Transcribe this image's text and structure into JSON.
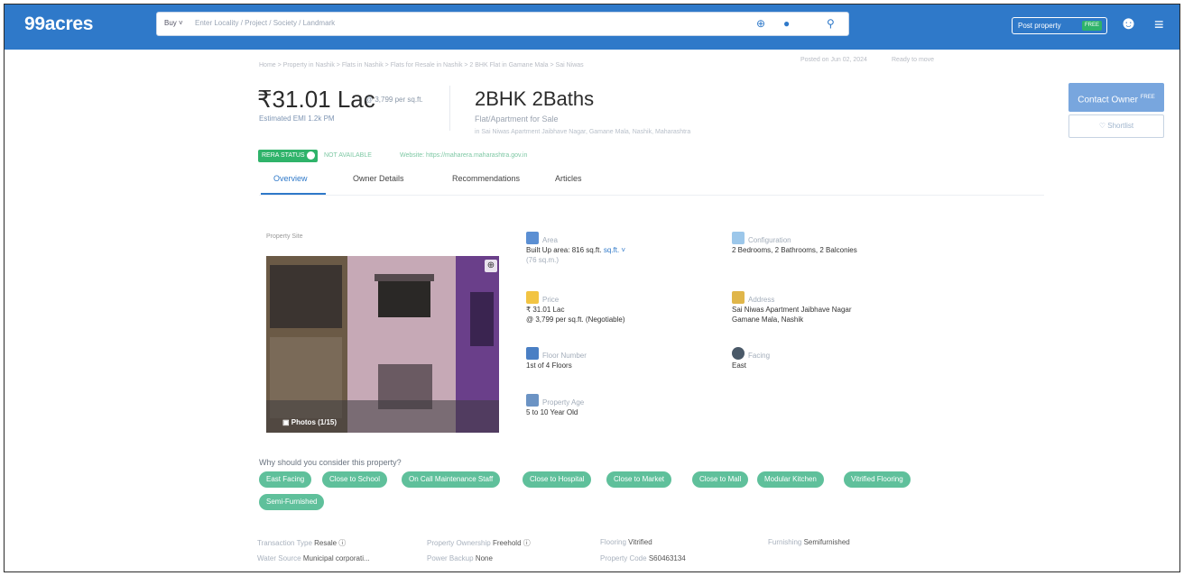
{
  "header": {
    "logo": "99acres",
    "buy_label": "Buy ˅",
    "search_placeholder": "Enter Locality / Project / Society / Landmark",
    "post_property_label": "Post property",
    "post_property_badge": "FREE"
  },
  "breadcrumb_text": "Home > Property in Nashik > Flats in Nashik > Flats for Resale in Nashik > 2 BHK Flat in Gamane Mala > Sai Niwas",
  "posted_text": "Posted on Jun 02, 2024",
  "ready_text": "Ready to move",
  "listing": {
    "price": "31.01 Lac",
    "price_sub": "@ 3,799 per sq.ft.",
    "estimated_emi": "Estimated EMI 1.2k PM",
    "title": "2BHK 2Baths",
    "subtitle": "Flat/Apartment for Sale",
    "address_line": "in Sai Niwas Apartment Jaibhave Nagar, Gamane Mala, Nashik, Maharashtra",
    "rera_status": "RERA STATUS",
    "rera_number": "NOT AVAILABLE",
    "rera_website": "Website: https://maharera.maharashtra.gov.in"
  },
  "actions": {
    "contact_owner": "Contact Owner",
    "contact_badge": "FREE",
    "shortlist": "♡ Shortlist"
  },
  "tabs": [
    "Overview",
    "Owner Details",
    "Recommendations",
    "Articles"
  ],
  "photo": {
    "label": "Property Site",
    "count": "▣ Photos (1/15)"
  },
  "attributes": {
    "area_key": "Area",
    "area_value": "Built Up area: 816 sq.ft.",
    "area_unit": "sq.ft. ˅",
    "area_more": "(76 sq.m.)",
    "config_key": "Configuration",
    "config_value": "2 Bedrooms, 2 Bathrooms, 2 Balconies",
    "price_key": "Price",
    "price_value": "₹ 31.01 Lac",
    "price_sub": "@ 3,799 per sq.ft. (Negotiable)",
    "address_key": "Address",
    "address_line1": "Sai Niwas Apartment Jaibhave Nagar",
    "address_line2": "Gamane Mala, Nashik",
    "floor_key": "Floor Number",
    "floor_value": "1st of 4 Floors",
    "facing_key": "Facing",
    "facing_value": "East",
    "age_key": "Property Age",
    "age_value": "5 to 10 Year Old"
  },
  "why": {
    "heading": "Why should you consider this property?",
    "chips": [
      "East Facing",
      "Close to School",
      "On Call Maintenance Staff",
      "Close to Hospital",
      "Close to Market",
      "Close to Mall",
      "Modular Kitchen",
      "Vitrified Flooring",
      "Semi-Furnished"
    ]
  },
  "footer_facts": [
    {
      "key": "Transaction Type",
      "value": "Resale ⓘ"
    },
    {
      "key": "Property Ownership",
      "value": "Freehold ⓘ"
    },
    {
      "key": "Flooring",
      "value": "Vitrified"
    },
    {
      "key": "Furnishing",
      "value": "Semifurnished"
    },
    {
      "key": "Water Source",
      "value": "Municipal corporati..."
    },
    {
      "key": "Power Backup",
      "value": "None"
    },
    {
      "key": "Property Code",
      "value": "S60463134"
    }
  ],
  "colors": {
    "brand": "#2f79c9",
    "chip": "#5fc09b",
    "badge": "#2fb36a"
  }
}
